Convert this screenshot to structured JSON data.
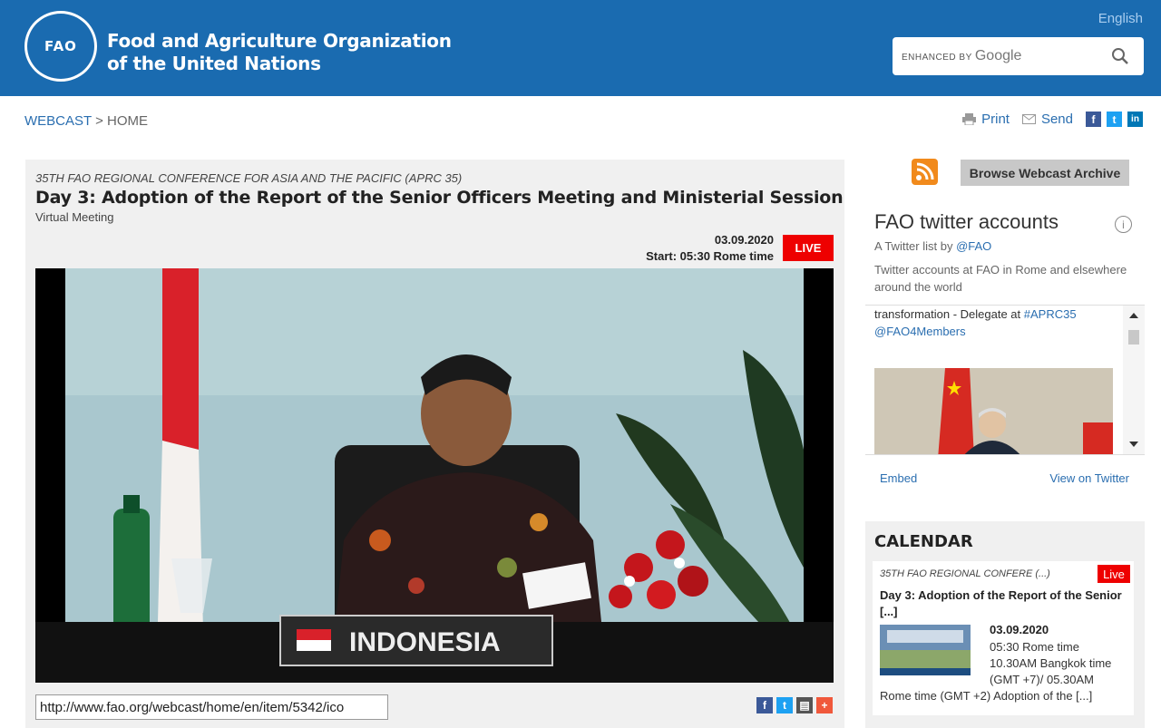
{
  "header": {
    "logo_text": "FAO",
    "org_line1": "Food and Agriculture Organization",
    "org_line2": "of the United Nations",
    "language": "English",
    "search_brand_small": "ENHANCED BY",
    "search_brand_google": "Google"
  },
  "breadcrumb": {
    "root": "WEBCAST",
    "sep": " > ",
    "current": "HOME"
  },
  "tools": {
    "print": "Print",
    "send": "Send",
    "facebook": "f",
    "twitter": "t",
    "linkedin": "in"
  },
  "event": {
    "conference": "35TH FAO REGIONAL CONFERENCE FOR ASIA AND THE PACIFIC (APRC 35)",
    "title": "Day 3: Adoption of the Report of the Senior Officers Meeting and Ministerial Session",
    "subtitle": "Virtual Meeting",
    "date": "03.09.2020",
    "start": "Start: 05:30  Rome time",
    "live": "LIVE",
    "nameplate": "INDONESIA",
    "url": "http://www.fao.org/webcast/home/en/item/5342/ico"
  },
  "sidebar": {
    "archive": "Browse Webcast Archive",
    "twitter_title": "FAO twitter accounts",
    "twitter_by": "A Twitter list by",
    "twitter_handle": "@FAO",
    "twitter_desc": "Twitter accounts at FAO in Rome and elsewhere around the world",
    "tweet_text": "transformation - Delegate at",
    "tweet_hashtag": "#APRC35",
    "tweet_mention": "@FAO4Members",
    "embed": "Embed",
    "view_on_twitter": "View on Twitter"
  },
  "calendar": {
    "heading": "CALENDAR",
    "conference": "35TH FAO REGIONAL CONFERE (...)",
    "live": "Live",
    "title": "Day 3: Adoption of the Report of the Senior [...]",
    "date": "03.09.2020",
    "desc": "05:30 Rome time\n 10.30AM Bangkok time (GMT +7)/ 05.30AM",
    "desc2": "Rome time (GMT +2) Adoption of the [...]"
  }
}
